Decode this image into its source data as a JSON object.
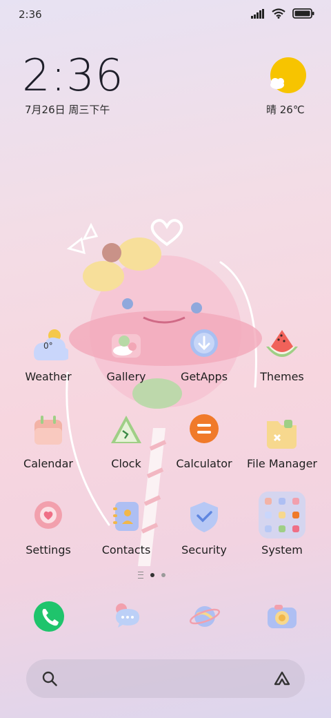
{
  "status_bar": {
    "time": "2:36",
    "icons": [
      "signal-icon",
      "wifi-icon",
      "battery-icon"
    ]
  },
  "clock_widget": {
    "time": "2:36",
    "date": "7月26日 周三下午"
  },
  "weather_widget": {
    "text": "晴 26℃",
    "icon": "partly-sunny-icon"
  },
  "apps": [
    {
      "label": "Weather",
      "icon": "weather-icon",
      "badge": "0°"
    },
    {
      "label": "Gallery",
      "icon": "gallery-icon"
    },
    {
      "label": "GetApps",
      "icon": "getapps-icon"
    },
    {
      "label": "Themes",
      "icon": "themes-icon"
    },
    {
      "label": "Calendar",
      "icon": "calendar-icon"
    },
    {
      "label": "Clock",
      "icon": "clock-icon"
    },
    {
      "label": "Calculator",
      "icon": "calculator-icon"
    },
    {
      "label": "File Manager",
      "icon": "file-manager-icon"
    },
    {
      "label": "Settings",
      "icon": "settings-icon"
    },
    {
      "label": "Contacts",
      "icon": "contacts-icon"
    },
    {
      "label": "Security",
      "icon": "security-icon"
    },
    {
      "label": "System",
      "icon": "system-folder-icon"
    }
  ],
  "dock": [
    "phone-icon",
    "messages-icon",
    "browser-icon",
    "camera-icon"
  ],
  "page_indicator": {
    "pages": 2,
    "current": 1
  },
  "colors": {
    "phone_green": "#1fc46c",
    "calculator_orange": "#f07a2a",
    "sun_yellow": "#f7c400"
  }
}
